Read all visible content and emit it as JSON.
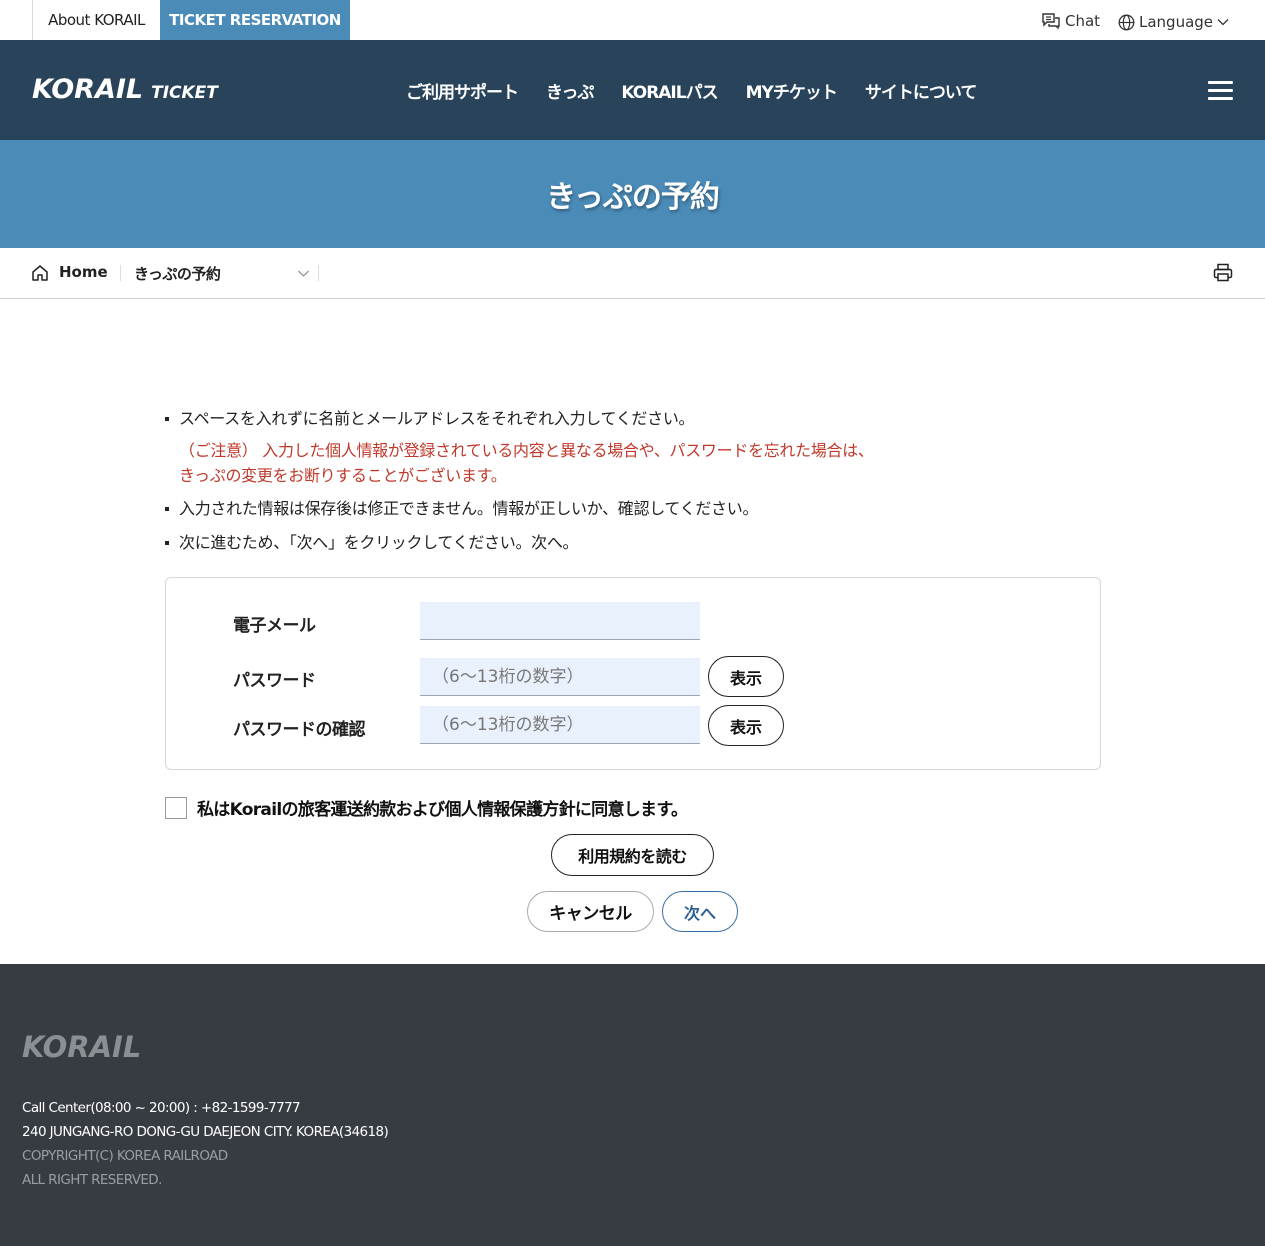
{
  "topbar": {
    "about_label": "About KORAIL",
    "ticket_label": "TICKET RESERVATION",
    "chat_label": "Chat",
    "language_label": "Language"
  },
  "nav": {
    "logo_main": "KORAIL",
    "logo_sub": "TICKET",
    "menu": [
      "ご利用サポート",
      "きっぷ",
      "KORAILパス",
      "MYチケット",
      "サイトについて"
    ]
  },
  "banner": {
    "title": "きっぷの予約"
  },
  "breadcrumb": {
    "home": "Home",
    "current": "きっぷの予約"
  },
  "notes": {
    "note1": "スペースを入れずに名前とメールアドレスをそれぞれ入力してください。",
    "caution_line1": "（ご注意） 入力した個人情報が登録されている内容と異なる場合や、パスワードを忘れた場合は、",
    "caution_line2": "きっぷの変更をお断りすることがございます。",
    "note2": "入力された情報は保存後は修正できません。情報が正しいか、確認してください。",
    "note3": "次に進むため、「次へ」をクリックしてください。次へ。"
  },
  "form": {
    "email_label": "電子メール",
    "email_value": "",
    "password_label": "パスワード",
    "password_placeholder": "（6～13桁の数字）",
    "confirm_label": "パスワードの確認",
    "confirm_placeholder": "（6～13桁の数字）",
    "show_label": "表示"
  },
  "agreement": {
    "label": "私はKorailの旅客運送約款および個人情報保護方針に同意します。",
    "checked": false
  },
  "buttons": {
    "terms": "利用規約を読む",
    "cancel": "キャンセル",
    "next": "次へ"
  },
  "footer": {
    "logo": "KORAIL",
    "call_center": "Call Center(08:00 ~ 20:00) : +82-1599-7777",
    "address": "240 JUNGANG-RO DONG-GU DAEJEON CITY. KOREA(34618)",
    "copyright": "COPYRIGHT(C) KOREA RAILROAD",
    "rights": "ALL RIGHT RESERVED."
  },
  "colors": {
    "nav_bg": "#28435a",
    "banner_bg": "#4b8bb8",
    "caution_text": "#c0392b",
    "input_bg": "#e9f1fc",
    "footer_bg": "#373c43"
  }
}
